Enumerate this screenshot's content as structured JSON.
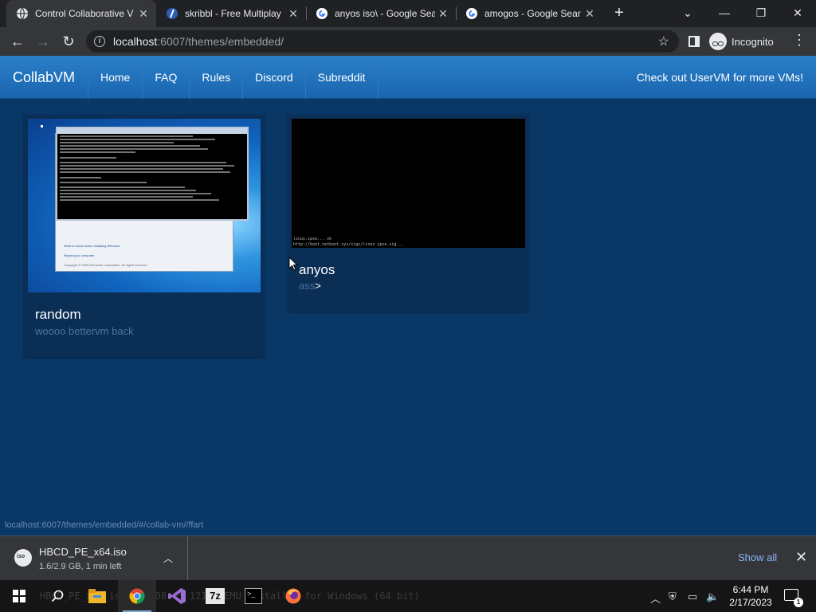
{
  "browser": {
    "tabs": [
      {
        "title": "Control Collaborative V",
        "icon": "globe-icon",
        "active": true
      },
      {
        "title": "skribbl - Free Multiplay",
        "icon": "skribbl-icon",
        "active": false
      },
      {
        "title": "anyos iso\\ - Google Sea",
        "icon": "google-icon",
        "active": false
      },
      {
        "title": "amogos - Google Sear",
        "icon": "google-icon",
        "active": false
      }
    ],
    "new_tab": "+",
    "close_glyph": "✕",
    "url_host": "localhost",
    "url_rest": ":6007/themes/embedded/",
    "incognito_label": "Incognito"
  },
  "site": {
    "brand": "CollabVM",
    "nav": [
      "Home",
      "FAQ",
      "Rules",
      "Discord",
      "Subreddit"
    ],
    "promo": "Check out UserVM for more VMs!"
  },
  "vms": [
    {
      "name": "random",
      "desc": "woooo bettervm back",
      "screen": "windows-setup-cmd"
    },
    {
      "name": "anyos",
      "desc_muted": "ass",
      "desc_tag": ">",
      "screen": "linux-boot",
      "console_lines": [
        "linux.ipxe... ok",
        "http://boot.netboot.xyz/sigs/linux.ipxe.sig... "
      ]
    }
  ],
  "windows_screen": {
    "setup_links": [
      "What to know before installing Windows",
      "Repair your computer",
      "Copyright © 2009 Microsoft Corporation. All rights reserved."
    ]
  },
  "status_url": "localhost:6007/themes/embedded/#/collab-vm//ffart",
  "downloads": {
    "file": "HBCD_PE_x64.iso",
    "status": "1.6/2.9 GB, 1 min left",
    "show_all": "Show all"
  },
  "taskbar": {
    "background_text": "HBCD_PE_x64_iso 319 08 65  121M  QEMU Installer for Windows (64 bit)",
    "apps": [
      "start-icon",
      "search-icon",
      "file-explorer-icon",
      "chrome-icon",
      "visual-studio-icon",
      "7zip-icon",
      "terminal-icon",
      "firefox-icon"
    ],
    "time": "6:44 PM",
    "date": "2/17/2023",
    "notification_count": "1"
  },
  "colors": {
    "page_bg": "#0a3866",
    "navbar": "#2a7fc8",
    "card_bg": "#0b2e55",
    "muted_text": "#4f73a0"
  }
}
